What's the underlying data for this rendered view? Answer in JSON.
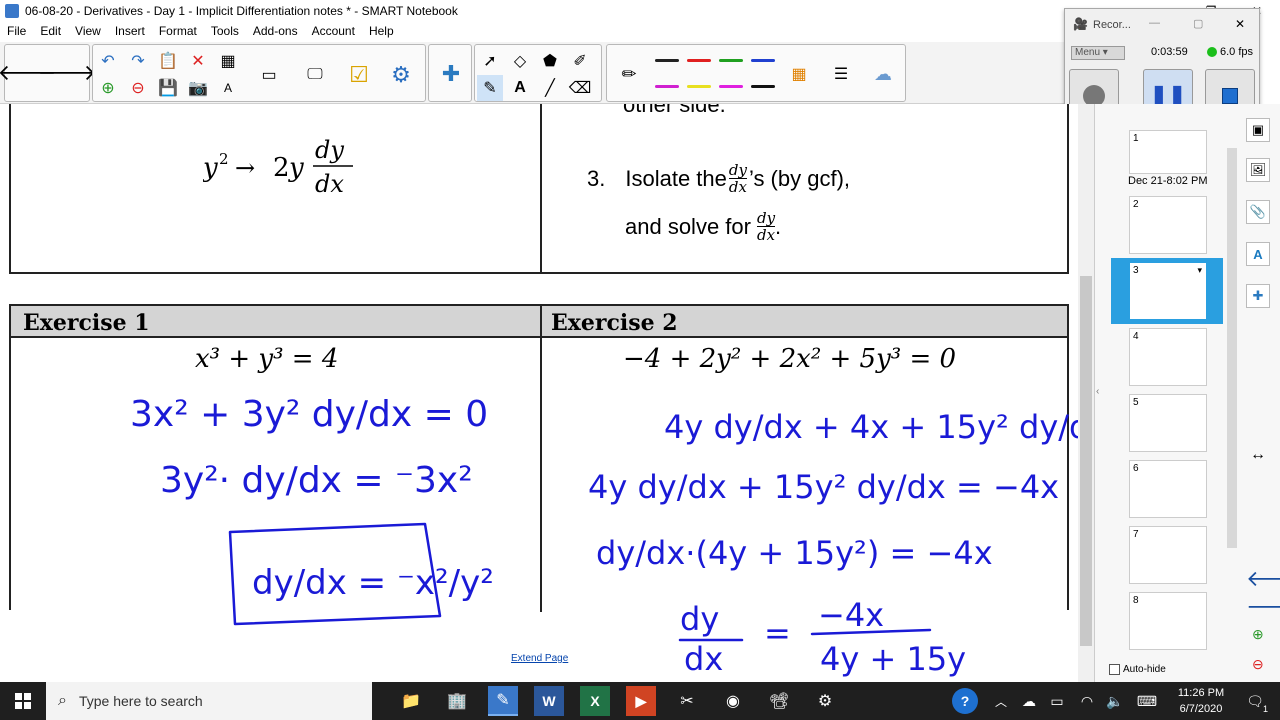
{
  "window": {
    "title": "06-08-20 - Derivatives - Day 1 - Implicit Differentiation notes * - SMART Notebook",
    "controls": [
      "—",
      "❐",
      "✕"
    ]
  },
  "menu": [
    "File",
    "Edit",
    "View",
    "Insert",
    "Format",
    "Tools",
    "Add-ons",
    "Account",
    "Help"
  ],
  "recorder": {
    "title": "Recor...",
    "menu_label": "Menu",
    "time": "0:03:59",
    "fps": "6.0 fps"
  },
  "page": {
    "top_left_formula": "y² → 2y dy/dx",
    "top_right_text": "other side.",
    "step3_number": "3.",
    "step3_line1": "Isolate the",
    "step3_line1_suffix": "’s (by gcf),",
    "step3_line2": "and solve for",
    "frac_num": "dy",
    "frac_den": "dx",
    "exercise1_header": "Exercise 1",
    "exercise1_equation": "x³ + y³ = 4",
    "exercise2_header": "Exercise 2",
    "exercise2_equation": "−4 + 2y² + 2x² + 5y³ = 0",
    "extend_link": "Extend Page",
    "ink_color": "#1a1ad6"
  },
  "sidepanel": {
    "date_label": "Dec 21-8:02 PM",
    "pages": [
      "1",
      "2",
      "3",
      "4",
      "5",
      "6",
      "7",
      "8"
    ],
    "selected_page": "3",
    "autohide_label": "Auto-hide"
  },
  "taskbar": {
    "search_placeholder": "Type here to search",
    "time": "11:26 PM",
    "date": "6/7/2020",
    "notification_count": "1"
  }
}
